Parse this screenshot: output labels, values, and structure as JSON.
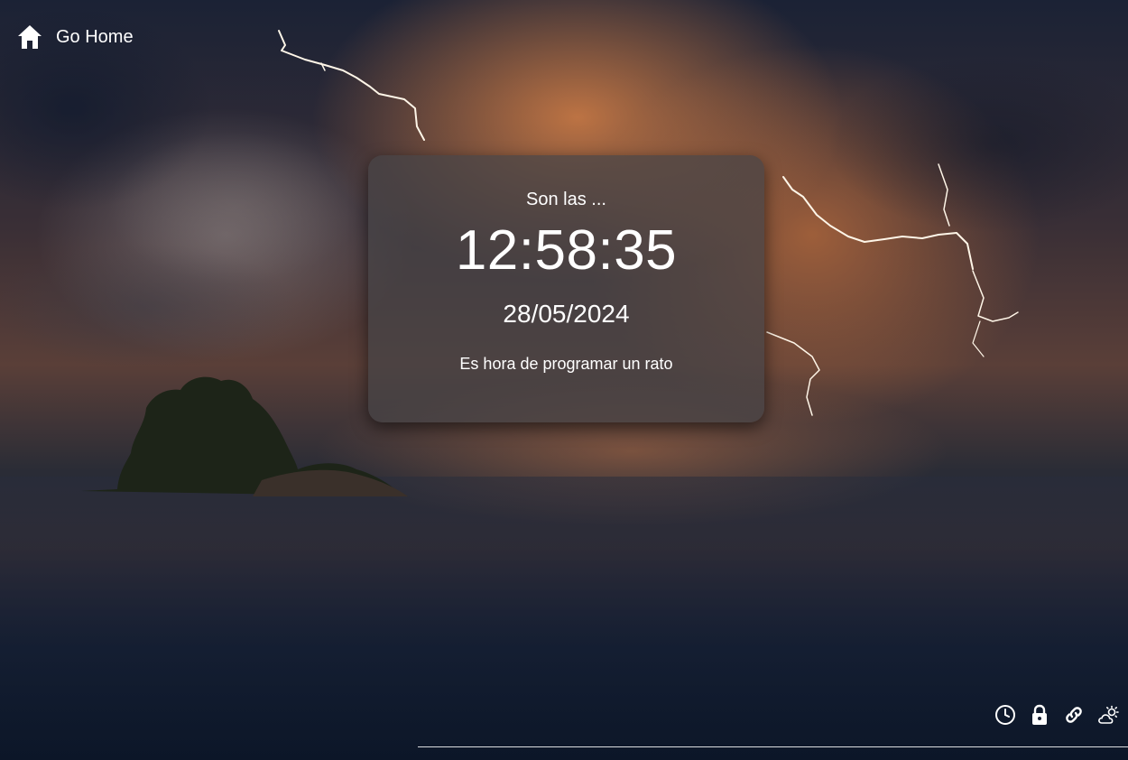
{
  "nav": {
    "home_label": "Go Home",
    "home_icon": "home-icon"
  },
  "clock": {
    "intro": "Son las ...",
    "time": "12:58:35",
    "date": "28/05/2024",
    "message": "Es hora de programar un rato"
  },
  "tools": [
    {
      "icon": "clock-icon"
    },
    {
      "icon": "lock-icon"
    },
    {
      "icon": "link-icon"
    },
    {
      "icon": "weather-icon"
    }
  ],
  "colors": {
    "text": "#ffffff",
    "card_background": "rgba(70,68,70,0.72)"
  }
}
